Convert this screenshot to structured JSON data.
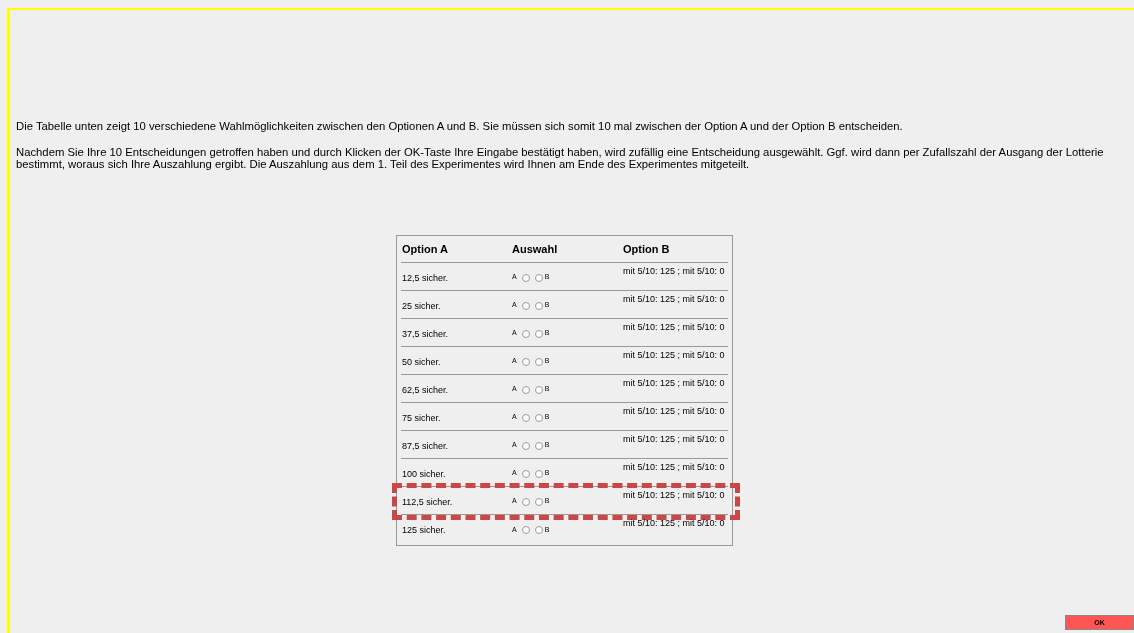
{
  "intro": [
    "Die Tabelle unten zeigt 10 verschiedene Wahlmöglichkeiten zwischen den Optionen A und B. Sie müssen sich somit 10 mal zwischen der Option A und der Option B entscheiden.",
    "Nachdem Sie Ihre 10 Entscheidungen getroffen haben und durch Klicken der OK-Taste Ihre Eingabe bestätigt haben, wird zufällig eine Entscheidung ausgewählt. Ggf. wird dann per Zufallszahl der Ausgang der Lotterie bestimmt, woraus sich Ihre Auszahlung ergibt. Die Auszahlung aus dem 1. Teil des Experimentes wird Ihnen am Ende des Experimentes mitgeteilt."
  ],
  "table": {
    "columns": [
      "Option A",
      "Auswahl",
      "Option B"
    ],
    "rows": [
      {
        "option_a": "12,5 sicher.",
        "label_a": "A",
        "a_selected": false,
        "b_selected": false,
        "label_b": "B",
        "option_b": "mit 5/10: 125 ; mit 5/10: 0",
        "highlighted": false
      },
      {
        "option_a": "25 sicher.",
        "label_a": "A",
        "a_selected": false,
        "b_selected": false,
        "label_b": "B",
        "option_b": "mit 5/10: 125 ; mit 5/10: 0",
        "highlighted": false
      },
      {
        "option_a": "37,5 sicher.",
        "label_a": "A",
        "a_selected": false,
        "b_selected": false,
        "label_b": "B",
        "option_b": "mit 5/10: 125 ; mit 5/10: 0",
        "highlighted": false
      },
      {
        "option_a": "50 sicher.",
        "label_a": "A",
        "a_selected": false,
        "b_selected": false,
        "label_b": "B",
        "option_b": "mit 5/10: 125 ; mit 5/10: 0",
        "highlighted": false
      },
      {
        "option_a": "62,5 sicher.",
        "label_a": "A",
        "a_selected": false,
        "b_selected": false,
        "label_b": "B",
        "option_b": "mit 5/10: 125 ; mit 5/10: 0",
        "highlighted": false
      },
      {
        "option_a": "75 sicher.",
        "label_a": "A",
        "a_selected": false,
        "b_selected": false,
        "label_b": "B",
        "option_b": "mit 5/10: 125 ; mit 5/10: 0",
        "highlighted": false
      },
      {
        "option_a": "87,5 sicher.",
        "label_a": "A",
        "a_selected": false,
        "b_selected": false,
        "label_b": "B",
        "option_b": "mit 5/10: 125 ; mit 5/10: 0",
        "highlighted": false
      },
      {
        "option_a": "100 sicher.",
        "label_a": "A",
        "a_selected": false,
        "b_selected": false,
        "label_b": "B",
        "option_b": "mit 5/10: 125 ; mit 5/10: 0",
        "highlighted": false
      },
      {
        "option_a": "112,5 sicher.",
        "label_a": "A",
        "a_selected": false,
        "b_selected": false,
        "label_b": "B",
        "option_b": "mit 5/10: 125 ; mit 5/10: 0",
        "highlighted": true
      },
      {
        "option_a": "125 sicher.",
        "label_a": "A",
        "a_selected": false,
        "b_selected": false,
        "label_b": "B",
        "option_b": "mit 5/10: 125 ; mit 5/10: 0",
        "highlighted": false
      }
    ]
  },
  "ok_button": "OK"
}
